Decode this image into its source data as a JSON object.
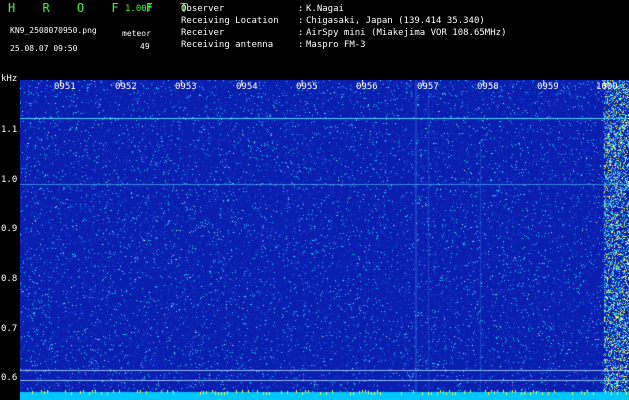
{
  "header": {
    "title": "H R O F F T",
    "version": "1.00f",
    "filename": "KN9_2508070950.png",
    "datetime": "25.08.07 09:50",
    "meteor_label": "meteor",
    "meteor_count": "49"
  },
  "metadata": [
    {
      "key": "Observer",
      "value": "K.Nagai"
    },
    {
      "key": "Receiving Location",
      "value": "Chigasaki, Japan (139.414 35.340)"
    },
    {
      "key": "Receiver",
      "value": "AirSpy mini (Miakejima VOR 108.65MHz)"
    },
    {
      "key": "Receiving antenna",
      "value": "Maspro FM-3"
    }
  ],
  "axis": {
    "unit": "kHz",
    "y_labels": [
      "1.1",
      "1.0",
      "0.9",
      "0.8",
      "0.7",
      "0.6"
    ],
    "x_labels": [
      "0951",
      "0952",
      "0953",
      "0954",
      "0955",
      "0956",
      "0957",
      "0958",
      "0959",
      "1000"
    ]
  },
  "colors": {
    "background": "#000000",
    "spectrogram_base": "#0a1fb0",
    "noise_dot": "#2fd6ff",
    "bright_dot": "#c8ffff",
    "bottom_band": "#00c8ff",
    "text_green": "#33ff33",
    "text_white": "#ffffff"
  }
}
